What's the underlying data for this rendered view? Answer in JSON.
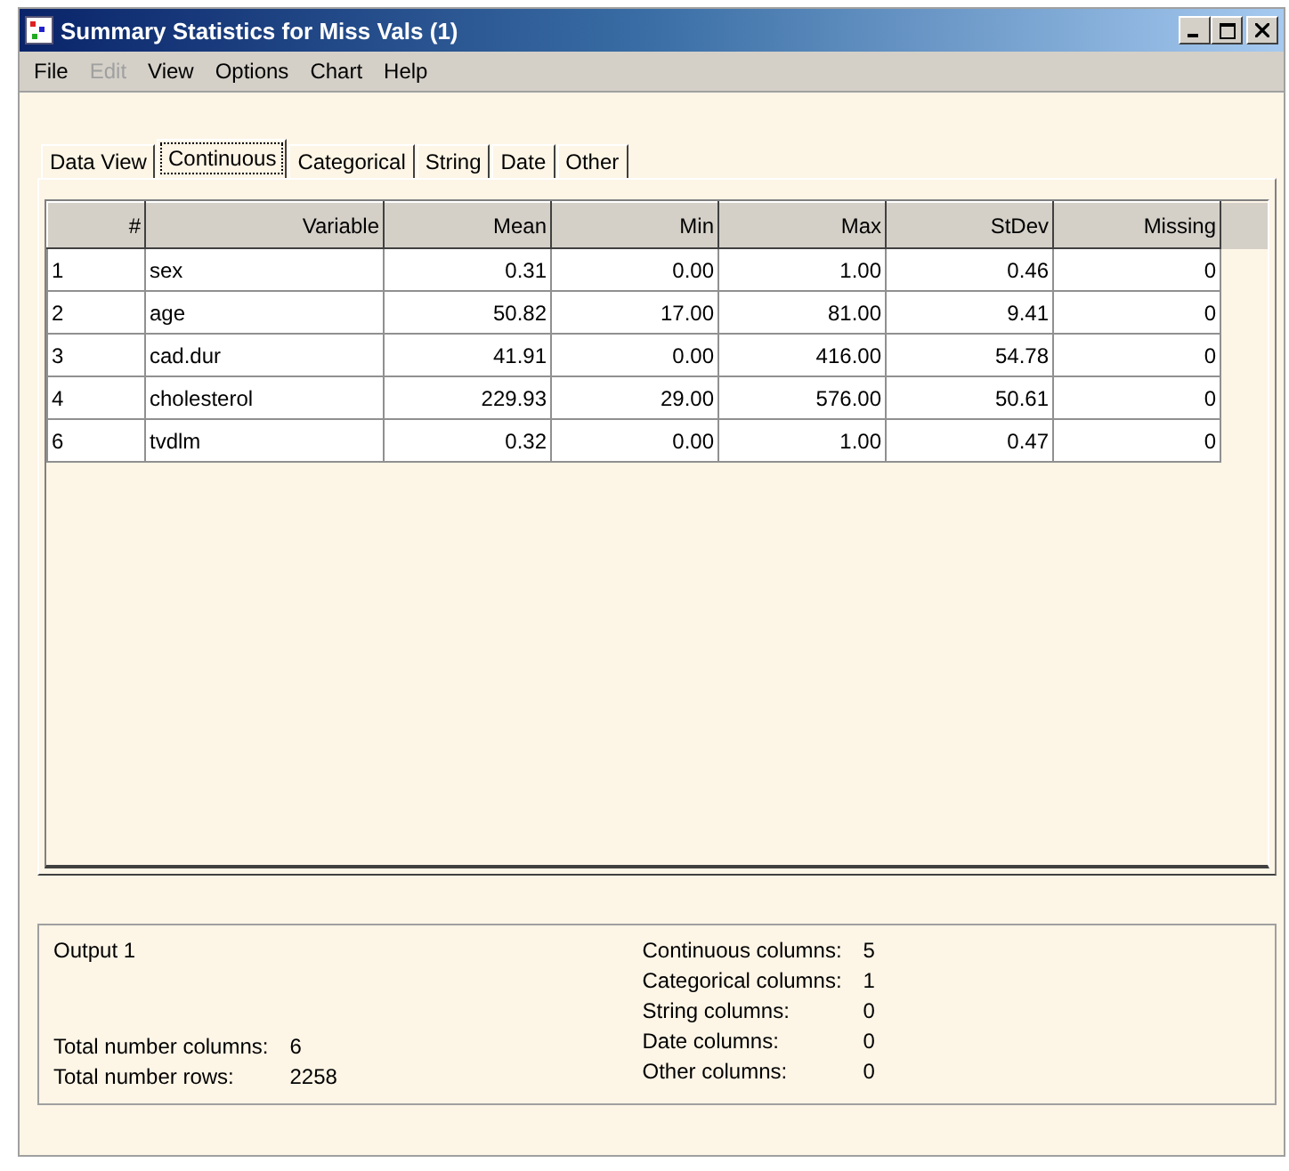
{
  "window": {
    "title": "Summary Statistics for Miss Vals (1)"
  },
  "menu": [
    {
      "label": "File",
      "disabled": false
    },
    {
      "label": "Edit",
      "disabled": true
    },
    {
      "label": "View",
      "disabled": false
    },
    {
      "label": "Options",
      "disabled": false
    },
    {
      "label": "Chart",
      "disabled": false
    },
    {
      "label": "Help",
      "disabled": false
    }
  ],
  "tabs": [
    {
      "label": "Data View",
      "selected": false
    },
    {
      "label": "Continuous",
      "selected": true
    },
    {
      "label": "Categorical",
      "selected": false
    },
    {
      "label": "String",
      "selected": false
    },
    {
      "label": "Date",
      "selected": false
    },
    {
      "label": "Other",
      "selected": false
    }
  ],
  "table": {
    "columns": [
      "#",
      "Variable",
      "Mean",
      "Min",
      "Max",
      "StDev",
      "Missing"
    ],
    "rows": [
      [
        "1",
        "sex",
        "0.31",
        "0.00",
        "1.00",
        "0.46",
        "0"
      ],
      [
        "2",
        "age",
        "50.82",
        "17.00",
        "81.00",
        "9.41",
        "0"
      ],
      [
        "3",
        "cad.dur",
        "41.91",
        "0.00",
        "416.00",
        "54.78",
        "0"
      ],
      [
        "4",
        "cholesterol",
        "229.93",
        "29.00",
        "576.00",
        "50.61",
        "0"
      ],
      [
        "6",
        "tvdlm",
        "0.32",
        "0.00",
        "1.00",
        "0.47",
        "0"
      ]
    ]
  },
  "summary": {
    "title": "Output 1",
    "totals": [
      {
        "label": "Total number columns:",
        "value": "6"
      },
      {
        "label": "Total number rows:",
        "value": "2258"
      }
    ],
    "counts": [
      {
        "label": "Continuous columns:",
        "value": "5"
      },
      {
        "label": "Categorical columns:",
        "value": "1"
      },
      {
        "label": "String columns:",
        "value": "0"
      },
      {
        "label": "Date columns:",
        "value": "0"
      },
      {
        "label": "Other columns:",
        "value": "0"
      }
    ]
  }
}
